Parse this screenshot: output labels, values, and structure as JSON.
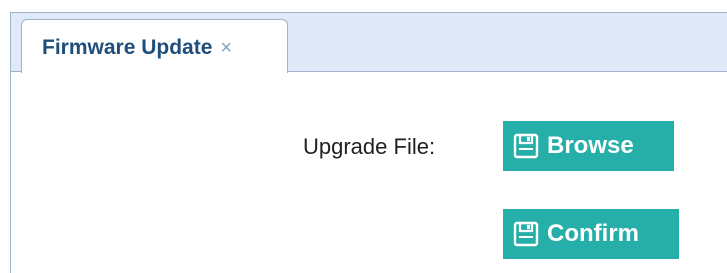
{
  "tab": {
    "title": "Firmware Update",
    "close_glyph": "×"
  },
  "form": {
    "upgrade_file_label": "Upgrade File:",
    "browse_label": "Browse",
    "confirm_label": "Confirm",
    "button_icon": "save-icon"
  },
  "colors": {
    "tab_bar_bg": "#dfe9f7",
    "tab_title": "#1e4f7a",
    "button_bg": "#26afa9",
    "border": "#9fb3cd"
  }
}
